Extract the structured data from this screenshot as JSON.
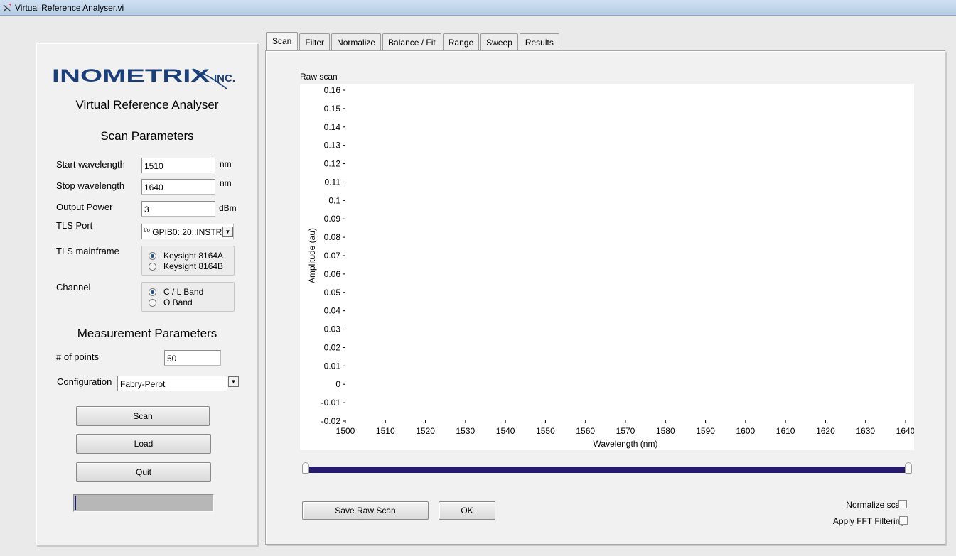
{
  "window": {
    "title": "Virtual Reference Analyser.vi"
  },
  "left": {
    "logo_main": "INOMETRIX",
    "logo_suffix": "INC.",
    "app_title": "Virtual Reference Analyser",
    "scan_params_heading": "Scan Parameters",
    "start_wavelength": {
      "label": "Start wavelength",
      "value": "1510",
      "unit": "nm"
    },
    "stop_wavelength": {
      "label": "Stop wavelength",
      "value": "1640",
      "unit": "nm"
    },
    "output_power": {
      "label": "Output Power",
      "value": "3",
      "unit": "dBm"
    },
    "tls_port": {
      "label": "TLS Port",
      "prefix": "I/o",
      "value": "GPIB0::20::INSTR"
    },
    "tls_mainframe": {
      "label": "TLS mainframe",
      "options": [
        "Keysight 8164A",
        "Keysight 8164B"
      ],
      "selected_index": 0
    },
    "channel": {
      "label": "Channel",
      "options": [
        "C / L Band",
        "O Band"
      ],
      "selected_index": 0
    },
    "measurement_heading": "Measurement Parameters",
    "num_points": {
      "label": "# of points",
      "value": "50"
    },
    "configuration": {
      "label": "Configuration",
      "value": "Fabry-Perot"
    },
    "buttons": {
      "scan": "Scan",
      "load": "Load",
      "quit": "Quit"
    },
    "progress_fraction": 0.01
  },
  "tabs": [
    "Scan",
    "Filter",
    "Normalize",
    "Balance / Fit",
    "Range",
    "Sweep",
    "Results"
  ],
  "active_tab": 0,
  "chart_data": {
    "type": "line",
    "title": "Raw scan",
    "xlabel": "Wavelength (nm)",
    "ylabel": "Amplitude (au)",
    "xlim": [
      1500,
      1640
    ],
    "ylim": [
      -0.02,
      0.16
    ],
    "x_ticks": [
      "1500",
      "1510",
      "1520",
      "1530",
      "1540",
      "1550",
      "1560",
      "1570",
      "1580",
      "1590",
      "1600",
      "1610",
      "1620",
      "1630",
      "1640"
    ],
    "y_ticks": [
      "0.16",
      "0.15",
      "0.14",
      "0.13",
      "0.12",
      "0.11",
      "0.1",
      "0.09",
      "0.08",
      "0.07",
      "0.06",
      "0.05",
      "0.04",
      "0.03",
      "0.02",
      "0.01",
      "0",
      "-0.01",
      "-0.02"
    ],
    "grid": false,
    "series": []
  },
  "range_slider": {
    "min_fraction": 0.0,
    "max_fraction": 1.0
  },
  "bottom": {
    "save_raw_scan": "Save Raw Scan",
    "ok": "OK",
    "normalize_scan": {
      "label": "Normalize scan",
      "checked": false
    },
    "apply_fft": {
      "label": "Apply FFT Filtering",
      "checked": false
    }
  },
  "colors": {
    "slider_track": "#261a6c",
    "logo": "#1c3f7a",
    "radio_dot": "#1b4f8a"
  }
}
